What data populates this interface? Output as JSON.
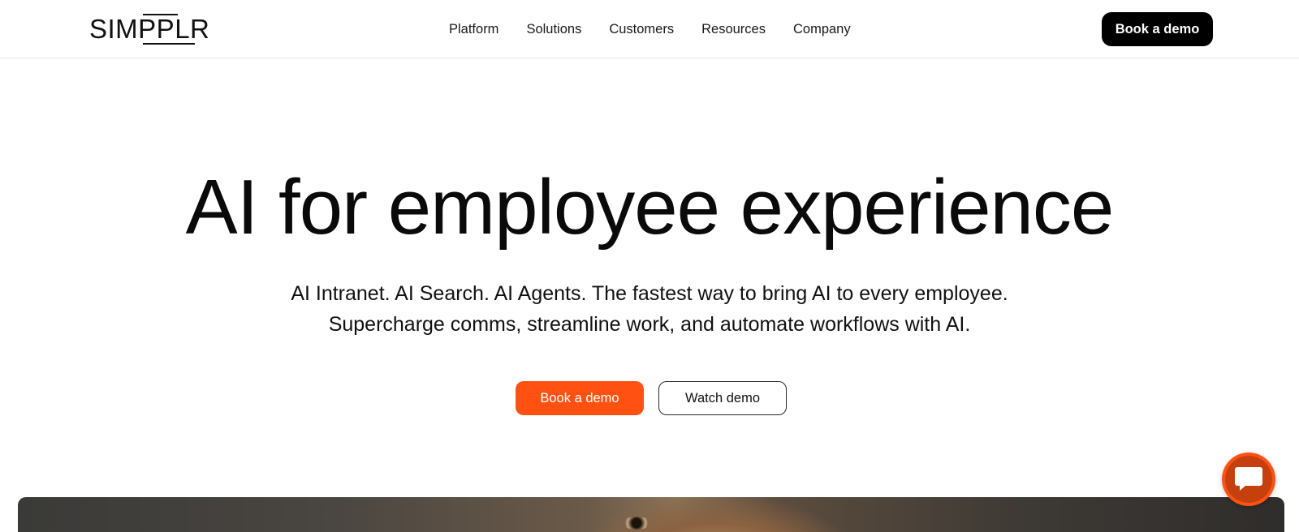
{
  "header": {
    "logo_text": "SIMPPLR",
    "nav": [
      {
        "label": "Platform"
      },
      {
        "label": "Solutions"
      },
      {
        "label": "Customers"
      },
      {
        "label": "Resources"
      },
      {
        "label": "Company"
      }
    ],
    "cta_label": "Book a demo"
  },
  "hero": {
    "title": "AI for employee experience",
    "subtitle_line1": "AI Intranet. AI Search. AI Agents. The fastest way to bring AI to every employee.",
    "subtitle_line2": "Supercharge comms, streamline work, and automate workflows with AI.",
    "primary_button": "Book a demo",
    "secondary_button": "Watch demo"
  },
  "chat": {
    "icon": "chat-bubble-icon"
  },
  "colors": {
    "accent": "#ff5112",
    "text": "#111111",
    "header_cta_bg": "#000000"
  }
}
